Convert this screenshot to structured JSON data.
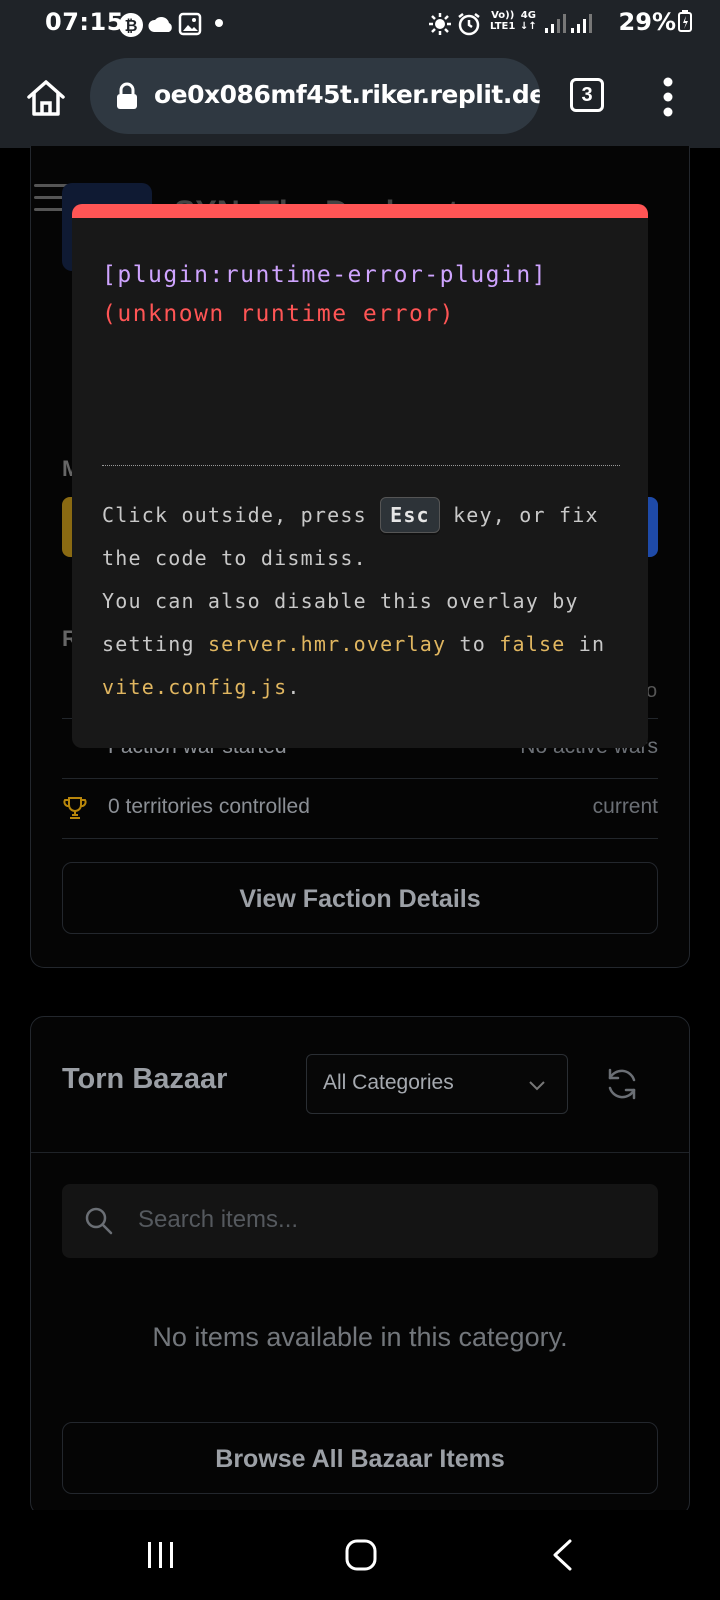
{
  "status_bar": {
    "time": "07:15",
    "network_top": "Vo))",
    "network_bottom": "LTE1",
    "network_type": "4G",
    "battery": "29%"
  },
  "browser": {
    "url": "oe0x086mf45t.riker.replit.de",
    "tab_count": "3"
  },
  "page": {
    "background_title": "SYN: The Docks at",
    "section_stub_1": "M",
    "section_stub_2": "R",
    "row_stub_right": "o",
    "rows": [
      {
        "text": "Faction war started",
        "meta": "No active wars"
      },
      {
        "text": "0 territories controlled",
        "meta": "current"
      }
    ],
    "view_faction_button": "View Faction Details",
    "bazaar": {
      "title": "Torn Bazaar",
      "category_select": "All Categories",
      "search_placeholder": "Search items...",
      "empty_message": "No items available in this category.",
      "browse_button": "Browse All Bazaar Items"
    }
  },
  "error_overlay": {
    "plugin": "[plugin:runtime-error-plugin]",
    "message": "(unknown runtime error)",
    "tip_1": "Click outside, press",
    "key": "Esc",
    "tip_2": "key, or fix the code to dismiss.",
    "tip_3": "You can also disable this overlay by setting",
    "code_1": "server.hmr.overlay",
    "tip_4": "to",
    "code_2": "false",
    "tip_5": "in",
    "code_3": "vite.config.js",
    "tip_6": "."
  },
  "colors": {
    "overlay_accent": "#ff5555",
    "plugin_text": "#cfa4ff",
    "code_text": "#e0b660"
  }
}
